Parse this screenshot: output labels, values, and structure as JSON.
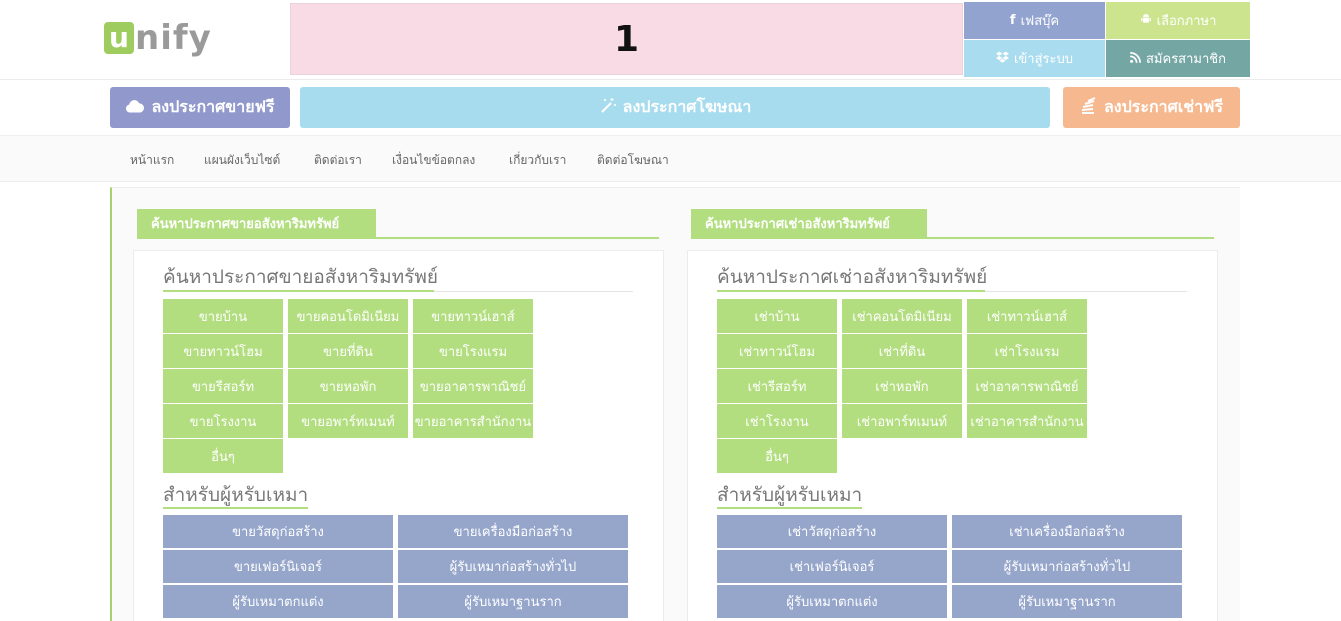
{
  "logo": {
    "letter": "u",
    "rest": "nify"
  },
  "banner": {
    "text": "1"
  },
  "topbar": {
    "facebook": "เฟสบุ๊ค",
    "language": "เลือกภาษา",
    "login": "เข้าสู่ระบบ",
    "register": "สมัครสามาชิก"
  },
  "post_buttons": {
    "sell": "ลงประกาศขายฟรี",
    "ad": "ลงประกาศโฆษณา",
    "rent": "ลงประกาศเช่าฟรี"
  },
  "nav": [
    "หน้าแรก",
    "แผนผังเว็บไซต์",
    "ติดต่อเรา",
    "เงื่อนไขข้อตกลง",
    "เกี่ยวกับเรา",
    "ติดต่อโฆษณา"
  ],
  "sell_section": {
    "tab": "ค้นหาประกาศขายอสังหาริมทรัพย์",
    "heading": "ค้นหาประกาศขายอสังหาริมทรัพย์",
    "grid": [
      "ขายบ้าน",
      "ขายคอนโดมิเนียม",
      "ขายทาวน์เฮาส์",
      "ขายทาวน์โฮม",
      "ขายที่ดิน",
      "ขายโรงแรม",
      "ขายรีสอร์ท",
      "ขายหอพัก",
      "ขายอาคารพาณิชย์",
      "ขายโรงงาน",
      "ขายอพาร์ทเมนท์",
      "ขายอาคารสำนักงาน",
      "อื่นๆ"
    ],
    "contractor_heading": "สำหรับผู้หรับเหมา",
    "contractor": [
      "ขายวัสดุก่อสร้าง",
      "ขายเครื่องมือก่อสร้าง",
      "ขายเฟอร์นิเจอร์",
      "ผู้รับเหมาก่อสร้างทั่วไป",
      "ผู้รับเหมาตกแต่ง",
      "ผู้รับเหมาฐานราก"
    ]
  },
  "rent_section": {
    "tab": "ค้นหาประกาศเช่าอสังหาริมทรัพย์",
    "heading": "ค้นหาประกาศเช่าอสังหาริมทรัพย์",
    "grid": [
      "เช่าบ้าน",
      "เช่าคอนโดมิเนียม",
      "เช่าทาวน์เฮาส์",
      "เช่าทาวน์โฮม",
      "เช่าที่ดิน",
      "เช่าโรงแรม",
      "เช่ารีสอร์ท",
      "เช่าหอพัก",
      "เช่าอาคารพาณิชย์",
      "เช่าโรงงาน",
      "เช่าอพาร์ทเมนท์",
      "เช่าอาคารสำนักงาน",
      "อื่นๆ"
    ],
    "contractor_heading": "สำหรับผู้หรับเหมา",
    "contractor": [
      "เช่าวัสดุก่อสร้าง",
      "เช่าเครื่องมือก่อสร้าง",
      "เช่าเฟอร์นิเจอร์",
      "ผู้รับเหมาก่อสร้างทั่วไป",
      "ผู้รับเหมาตกแต่ง",
      "ผู้รับเหมาฐานราก"
    ]
  },
  "colors": {
    "accent_green": "#b3de80",
    "accent_blue": "#96a6cb",
    "banner_pink": "#f8dbe4"
  }
}
